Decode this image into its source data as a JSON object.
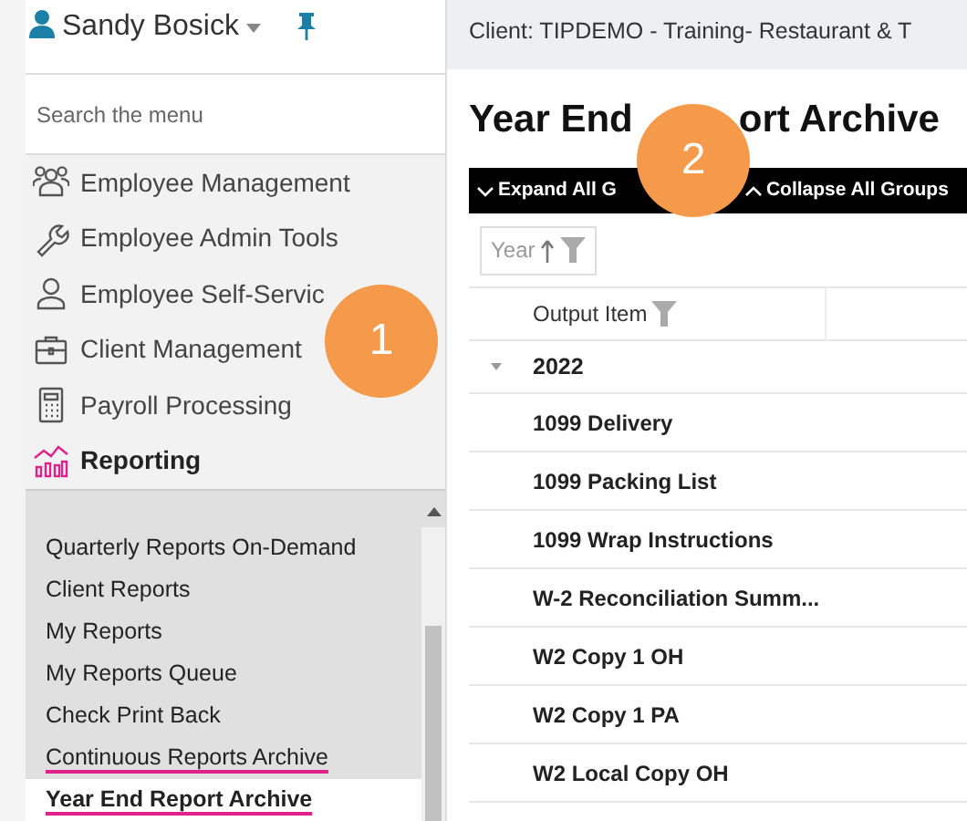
{
  "user": {
    "name": "Sandy Bosick"
  },
  "search": {
    "placeholder": "Search the menu"
  },
  "menu": [
    {
      "label": "Employee Management",
      "kind": "people",
      "selected": false
    },
    {
      "label": "Employee Admin Tools",
      "kind": "wrench",
      "selected": false
    },
    {
      "label": "Employee Self-Servic",
      "kind": "person",
      "selected": false
    },
    {
      "label": "Client Management",
      "kind": "briefcase",
      "selected": false
    },
    {
      "label": "Payroll Processing",
      "kind": "calculator",
      "selected": false
    },
    {
      "label": "Reporting",
      "kind": "chart",
      "selected": true
    }
  ],
  "submenu": [
    {
      "label": "Quarterly Reports On-Demand",
      "selected": false,
      "underlined": false
    },
    {
      "label": "Client Reports",
      "selected": false,
      "underlined": false
    },
    {
      "label": "My Reports",
      "selected": false,
      "underlined": false
    },
    {
      "label": "My Reports Queue",
      "selected": false,
      "underlined": false
    },
    {
      "label": "Check Print Back",
      "selected": false,
      "underlined": false
    },
    {
      "label": "Continuous Reports Archive",
      "selected": false,
      "underlined": true
    },
    {
      "label": "Year End Report Archive",
      "selected": true,
      "underlined": true
    }
  ],
  "client_bar": "Client: TIPDEMO - Training- Restaurant & T",
  "page_title": [
    "Year End",
    "ort Archive"
  ],
  "toolbar": [
    {
      "label": "Expand All G",
      "kind": "expand"
    },
    {
      "label": "Collapse All Groups",
      "kind": "collapse"
    }
  ],
  "group_chip": {
    "label": "Year"
  },
  "table": {
    "columns": [
      "Output Item"
    ],
    "groups": [
      {
        "label": "2022",
        "expanded": true,
        "rows": [
          "1099 Delivery",
          "1099 Packing List",
          "1099 Wrap Instructions",
          "W-2 Reconciliation Summ...",
          "W2 Copy 1 OH",
          "W2 Copy 1 PA",
          "W2 Local Copy OH"
        ]
      }
    ]
  },
  "callouts": [
    "1",
    "2"
  ]
}
